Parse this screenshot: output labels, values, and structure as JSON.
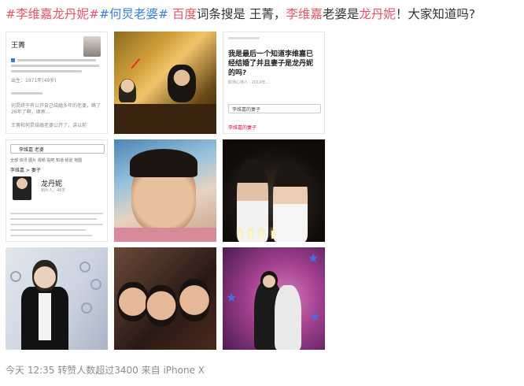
{
  "post": {
    "topic1": "#李维嘉龙丹妮#",
    "topic2": "#何炅老婆#",
    "baidu": "百度",
    "text1": "词条搜是 王菁，",
    "name1": "李维嘉",
    "text2": "老婆是",
    "name2": "龙丹妮",
    "text3": "！大家知道吗?"
  },
  "images": {
    "card1": {
      "name": "王菁",
      "year_line": "出生：1971年(49岁)",
      "news_line1": "何炅终于有公开自己结婚多年的老婆，瞒了26年了啊，继承...",
      "news_line2": "王菁和何炅结婚老婆公开了，讲以前"
    },
    "card3": {
      "question": "我是最后一个知道李维嘉已经结婚了并且妻子是龙丹妮的吗?",
      "meta": "职场心林人 · 2019年...",
      "search_text": "李维嘉的妻子",
      "hint": "李维嘉的妻子"
    },
    "card4": {
      "search_text": "李维嘉 老婆",
      "tabs": "全部   资讯   图片   视频   贴吧   知道   经验   地图",
      "subtitle": "李维嘉 > 妻子",
      "wife_name": "龙丹妮",
      "wife_sub": "制片人，48岁"
    }
  },
  "footer": {
    "time": "今天 12:35",
    "reposts": "转赞人数超过3400",
    "source_prefix": "来自",
    "device": "iPhone X"
  }
}
